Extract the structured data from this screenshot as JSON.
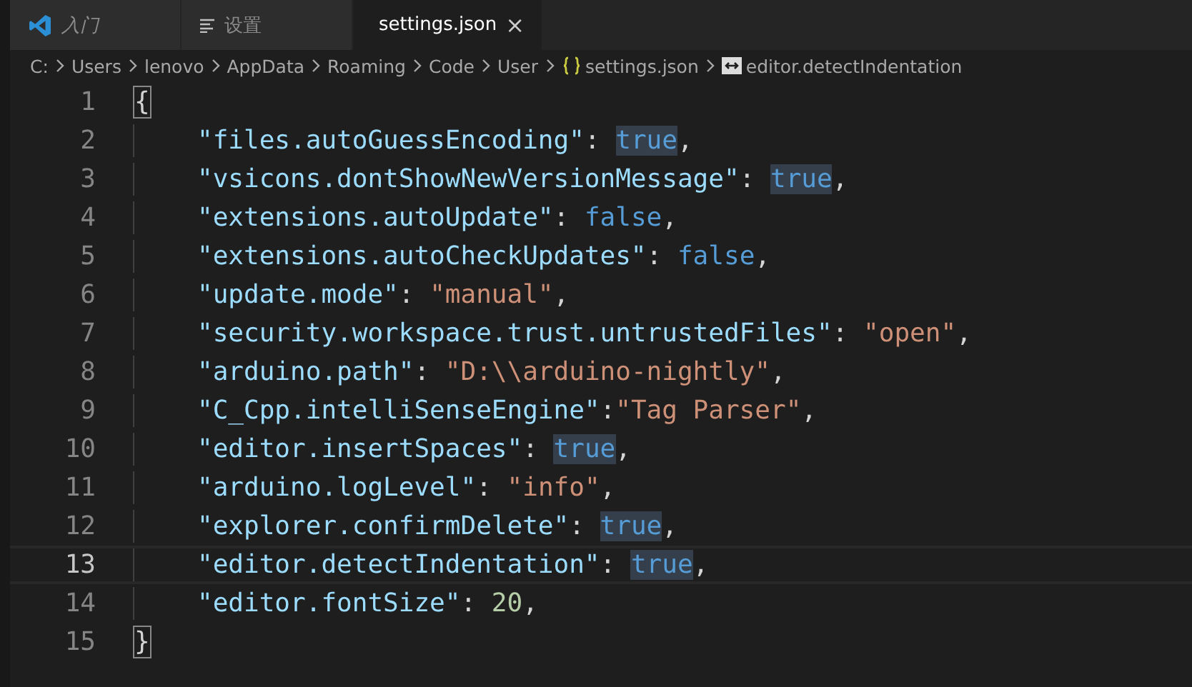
{
  "tabs": [
    {
      "label": "入门",
      "kind": "welcome",
      "selected": false
    },
    {
      "label": "设置",
      "kind": "settings",
      "selected": false
    },
    {
      "label": "settings.json",
      "kind": "file",
      "selected": true,
      "close": "×"
    }
  ],
  "breadcrumb": [
    {
      "label": "C:",
      "kind": "folder"
    },
    {
      "label": "Users",
      "kind": "folder"
    },
    {
      "label": "lenovo",
      "kind": "folder"
    },
    {
      "label": "AppData",
      "kind": "folder"
    },
    {
      "label": "Roaming",
      "kind": "folder"
    },
    {
      "label": "Code",
      "kind": "folder"
    },
    {
      "label": "User",
      "kind": "folder"
    },
    {
      "label": "settings.json",
      "kind": "file"
    },
    {
      "label": "editor.detectIndentation",
      "kind": "property"
    }
  ],
  "lines": [
    {
      "number": "1",
      "current": false,
      "indented": false,
      "tokens": [
        {
          "text": "{",
          "kind": "brace",
          "matched": true
        }
      ]
    },
    {
      "number": "2",
      "current": false,
      "indented": true,
      "tokens": [
        {
          "text": "\"files.autoGuessEncoding\"",
          "kind": "key"
        },
        {
          "text": ": ",
          "kind": "punct"
        },
        {
          "text": "true",
          "kind": "bool",
          "highlighted": true
        },
        {
          "text": ",",
          "kind": "punct"
        }
      ]
    },
    {
      "number": "3",
      "current": false,
      "indented": true,
      "tokens": [
        {
          "text": "\"vsicons.dontShowNewVersionMessage\"",
          "kind": "key"
        },
        {
          "text": ": ",
          "kind": "punct"
        },
        {
          "text": "true",
          "kind": "bool",
          "highlighted": true
        },
        {
          "text": ",",
          "kind": "punct"
        }
      ]
    },
    {
      "number": "4",
      "current": false,
      "indented": true,
      "tokens": [
        {
          "text": "\"extensions.autoUpdate\"",
          "kind": "key"
        },
        {
          "text": ": ",
          "kind": "punct"
        },
        {
          "text": "false",
          "kind": "bool",
          "highlighted": false
        },
        {
          "text": ",",
          "kind": "punct"
        }
      ]
    },
    {
      "number": "5",
      "current": false,
      "indented": true,
      "tokens": [
        {
          "text": "\"extensions.autoCheckUpdates\"",
          "kind": "key"
        },
        {
          "text": ": ",
          "kind": "punct"
        },
        {
          "text": "false",
          "kind": "bool",
          "highlighted": false
        },
        {
          "text": ",",
          "kind": "punct"
        }
      ]
    },
    {
      "number": "6",
      "current": false,
      "indented": true,
      "tokens": [
        {
          "text": "\"update.mode\"",
          "kind": "key"
        },
        {
          "text": ": ",
          "kind": "punct"
        },
        {
          "text": "\"manual\"",
          "kind": "string"
        },
        {
          "text": ",",
          "kind": "punct"
        }
      ]
    },
    {
      "number": "7",
      "current": false,
      "indented": true,
      "tokens": [
        {
          "text": "\"security.workspace.trust.untrustedFiles\"",
          "kind": "key"
        },
        {
          "text": ": ",
          "kind": "punct"
        },
        {
          "text": "\"open\"",
          "kind": "string"
        },
        {
          "text": ",",
          "kind": "punct"
        }
      ]
    },
    {
      "number": "8",
      "current": false,
      "indented": true,
      "tokens": [
        {
          "text": "\"arduino.path\"",
          "kind": "key"
        },
        {
          "text": ": ",
          "kind": "punct"
        },
        {
          "text": "\"D:\\\\arduino-nightly\"",
          "kind": "string"
        },
        {
          "text": ",",
          "kind": "punct"
        }
      ]
    },
    {
      "number": "9",
      "current": false,
      "indented": true,
      "tokens": [
        {
          "text": "\"C_Cpp.intelliSenseEngine\"",
          "kind": "key"
        },
        {
          "text": ":",
          "kind": "punct"
        },
        {
          "text": "\"Tag Parser\"",
          "kind": "string"
        },
        {
          "text": ",",
          "kind": "punct"
        }
      ]
    },
    {
      "number": "10",
      "current": false,
      "indented": true,
      "tokens": [
        {
          "text": "\"editor.insertSpaces\"",
          "kind": "key"
        },
        {
          "text": ": ",
          "kind": "punct"
        },
        {
          "text": "true",
          "kind": "bool",
          "highlighted": true
        },
        {
          "text": ",",
          "kind": "punct"
        }
      ]
    },
    {
      "number": "11",
      "current": false,
      "indented": true,
      "tokens": [
        {
          "text": "\"arduino.logLevel\"",
          "kind": "key"
        },
        {
          "text": ": ",
          "kind": "punct"
        },
        {
          "text": "\"info\"",
          "kind": "string"
        },
        {
          "text": ",",
          "kind": "punct"
        }
      ]
    },
    {
      "number": "12",
      "current": false,
      "indented": true,
      "tokens": [
        {
          "text": "\"explorer.confirmDelete\"",
          "kind": "key"
        },
        {
          "text": ": ",
          "kind": "punct"
        },
        {
          "text": "true",
          "kind": "bool",
          "highlighted": true
        },
        {
          "text": ",",
          "kind": "punct"
        }
      ]
    },
    {
      "number": "13",
      "current": true,
      "indented": true,
      "tokens": [
        {
          "text": "\"editor.detectIndentation\"",
          "kind": "key"
        },
        {
          "text": ": ",
          "kind": "punct"
        },
        {
          "text": "true",
          "kind": "bool",
          "highlighted": true
        },
        {
          "text": ",",
          "kind": "punct"
        }
      ]
    },
    {
      "number": "14",
      "current": false,
      "indented": true,
      "tokens": [
        {
          "text": "\"editor.fontSize\"",
          "kind": "key"
        },
        {
          "text": ": ",
          "kind": "punct"
        },
        {
          "text": "20",
          "kind": "number"
        },
        {
          "text": ",",
          "kind": "punct"
        }
      ]
    },
    {
      "number": "15",
      "current": false,
      "indented": false,
      "tokens": [
        {
          "text": "}",
          "kind": "brace",
          "matched": true
        }
      ]
    }
  ]
}
